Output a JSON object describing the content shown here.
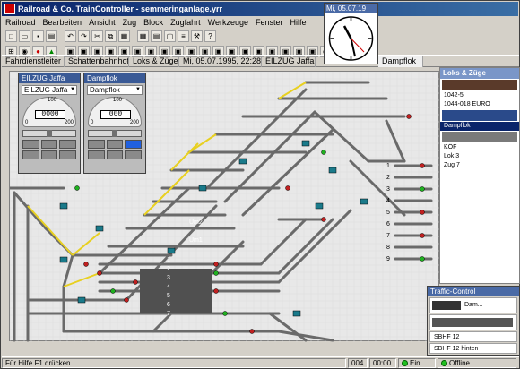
{
  "window": {
    "title": "Railroad & Co. TrainController - semmeringanlage.yrr"
  },
  "menu": [
    "Railroad",
    "Bearbeiten",
    "Ansicht",
    "Zug",
    "Block",
    "Zugfahrt",
    "Werkzeuge",
    "Fenster",
    "Hilfe"
  ],
  "tabs": [
    {
      "label": "Fahrdienstleiter"
    },
    {
      "label": "Schattenbahnhof"
    },
    {
      "label": "Loks & Züge"
    },
    {
      "label": "Mi, 05.07.1995, 22:28, ..."
    },
    {
      "label": "EILZUG Jaffa"
    },
    {
      "label": "Dampflok"
    }
  ],
  "clock": {
    "title": "Mi, 05.07.19"
  },
  "controllers": [
    {
      "title": "EILZUG Jaffa",
      "select": "EILZUG Jaffa",
      "digits": "0000",
      "gauge_min": "0",
      "gauge_mid": "100",
      "gauge_max": "200"
    },
    {
      "title": "Dampflok",
      "select": "Dampflok",
      "digits": "000",
      "gauge_min": "0",
      "gauge_mid": "100",
      "gauge_max": "200"
    }
  ],
  "locos_panel": {
    "title": "Loks & Züge",
    "items": [
      {
        "label": "1042-5"
      },
      {
        "label": "1044-018 EURO"
      },
      {
        "label": "Dampflok"
      },
      {
        "label": "KÖF"
      },
      {
        "label": "Lok 3"
      },
      {
        "label": "Zug 7"
      }
    ]
  },
  "traffic_control": {
    "title": "Traffic-Control",
    "loco": "Dam...",
    "rows": [
      {
        "label": "SBHF 12"
      },
      {
        "label": "SBHF 12 hinten"
      }
    ]
  },
  "track_numbers": [
    "1",
    "2",
    "3",
    "4",
    "5",
    "6",
    "7",
    "8",
    "9"
  ],
  "track_labels": [
    "Um2",
    "Um1",
    "1",
    "2",
    "3",
    "4",
    "5",
    "6",
    "7"
  ],
  "statusbar": {
    "help": "Für Hilfe F1 drücken",
    "code": "004",
    "time": "00:00",
    "mode": "Ein",
    "state": "Offline"
  }
}
